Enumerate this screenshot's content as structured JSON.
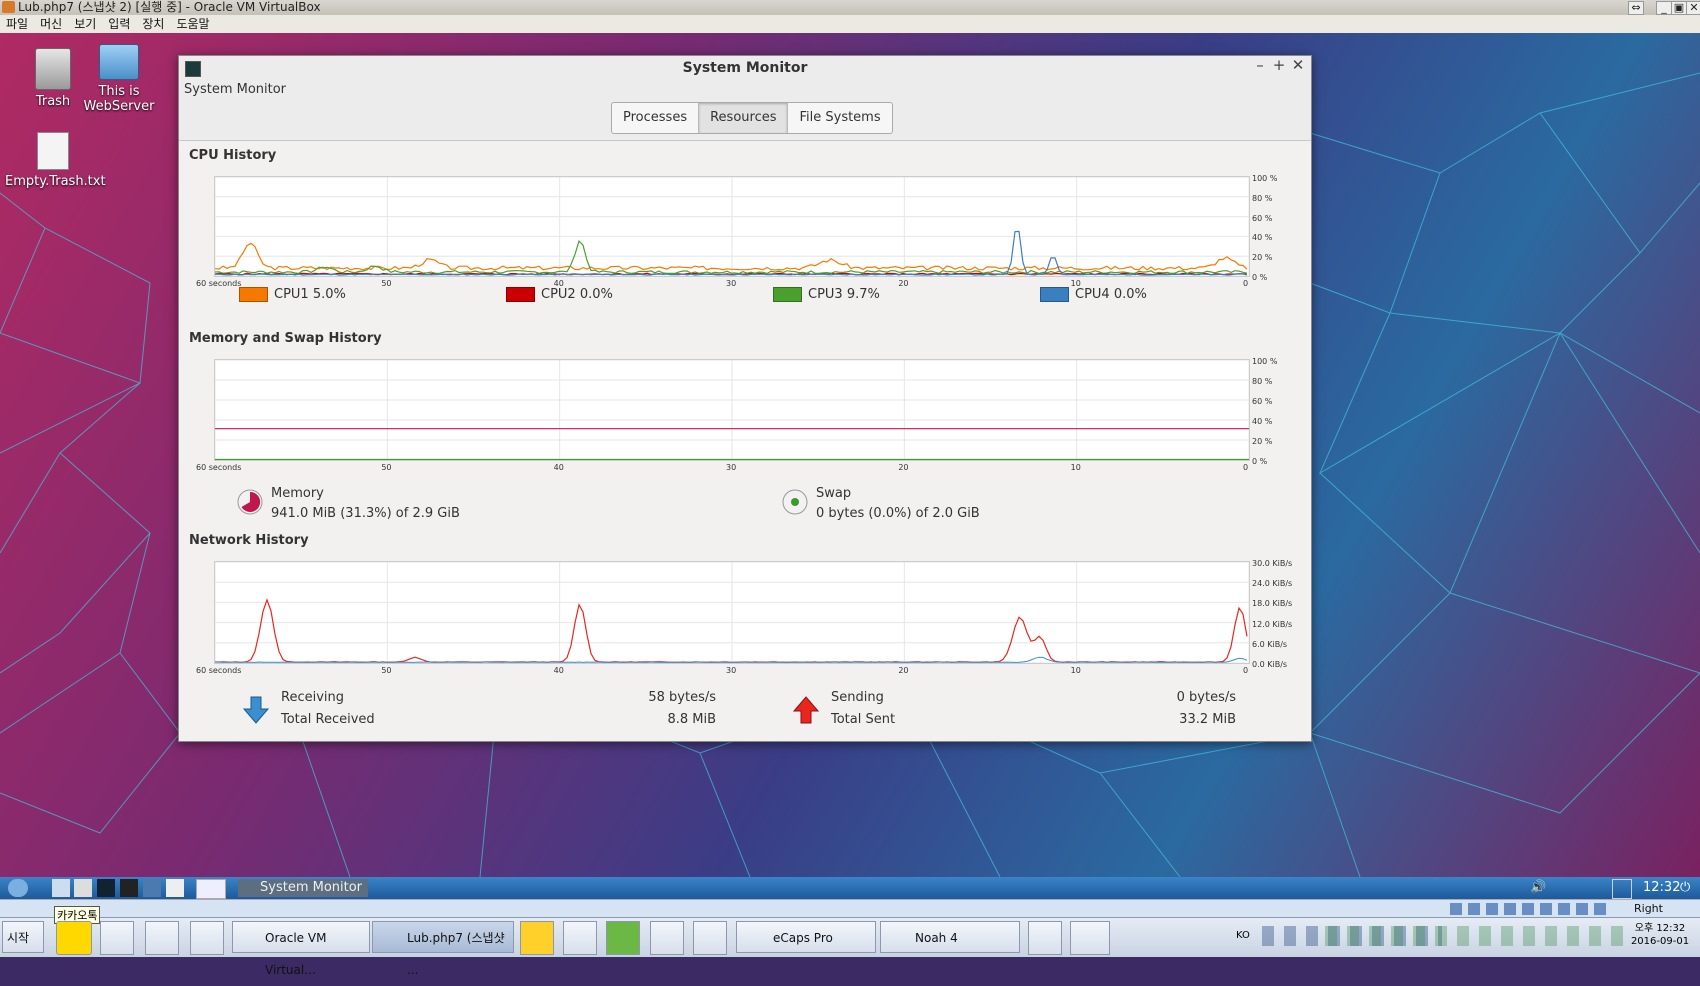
{
  "host": {
    "title": "Lub.php7 (스냅샷 2) [실행 중] - Oracle VM VirtualBox",
    "menu": [
      "파일",
      "머신",
      "보기",
      "입력",
      "장치",
      "도움말"
    ]
  },
  "desktop_icons": [
    {
      "label": "Trash"
    },
    {
      "label": "This is WebServer"
    },
    {
      "label": "Empty.Trash.txt"
    }
  ],
  "window": {
    "title": "System Monitor",
    "subtitle": "System Monitor",
    "tabs": [
      "Processes",
      "Resources",
      "File Systems"
    ],
    "selected_tab": "Resources"
  },
  "x_ticks": [
    "60 seconds",
    "50",
    "40",
    "30",
    "20",
    "10",
    "0"
  ],
  "cpu": {
    "section_title": "CPU History",
    "y_ticks": [
      "100 %",
      "80 %",
      "60 %",
      "40 %",
      "20 %",
      "0 %"
    ],
    "legend": [
      {
        "name": "CPU1",
        "value": "5.0%",
        "color": "#f57900"
      },
      {
        "name": "CPU2",
        "value": "0.0%",
        "color": "#cc0000"
      },
      {
        "name": "CPU3",
        "value": "9.7%",
        "color": "#4aa02c"
      },
      {
        "name": "CPU4",
        "value": "0.0%",
        "color": "#3a7fbf"
      }
    ]
  },
  "memory": {
    "section_title": "Memory and Swap History",
    "y_ticks": [
      "100 %",
      "80 %",
      "60 %",
      "40 %",
      "20 %",
      "0 %"
    ],
    "memory_label": "Memory",
    "memory_value": "941.0 MiB (31.3%) of 2.9 GiB",
    "memory_color": "#c0184e",
    "swap_label": "Swap",
    "swap_value": "0 bytes (0.0%) of 2.0 GiB",
    "swap_color": "#3a9a2a"
  },
  "network": {
    "section_title": "Network History",
    "y_ticks": [
      "30.0 KiB/s",
      "24.0 KiB/s",
      "18.0 KiB/s",
      "12.0 KiB/s",
      "6.0 KiB/s",
      "0.0 KiB/s"
    ],
    "receiving_label": "Receiving",
    "receiving_value": "58 bytes/s",
    "total_received_label": "Total Received",
    "total_received_value": "8.8 MiB",
    "sending_label": "Sending",
    "sending_value": "0 bytes/s",
    "total_sent_label": "Total Sent",
    "total_sent_value": "33.2 MiB"
  },
  "guest_panel": {
    "active_window": "System Monitor",
    "clock": "12:32"
  },
  "host_status": {
    "right_control": "Right Control"
  },
  "host_taskbar": {
    "start": "시작",
    "tooltip": "카카오톡",
    "items": [
      "Oracle VM Virtual...",
      "Lub.php7 (스냅샷 ...",
      "eCaps Pro",
      "Noah 4"
    ],
    "ime": "KO",
    "clock_time": "오후 12:32",
    "clock_date": "2016-09-01"
  }
}
